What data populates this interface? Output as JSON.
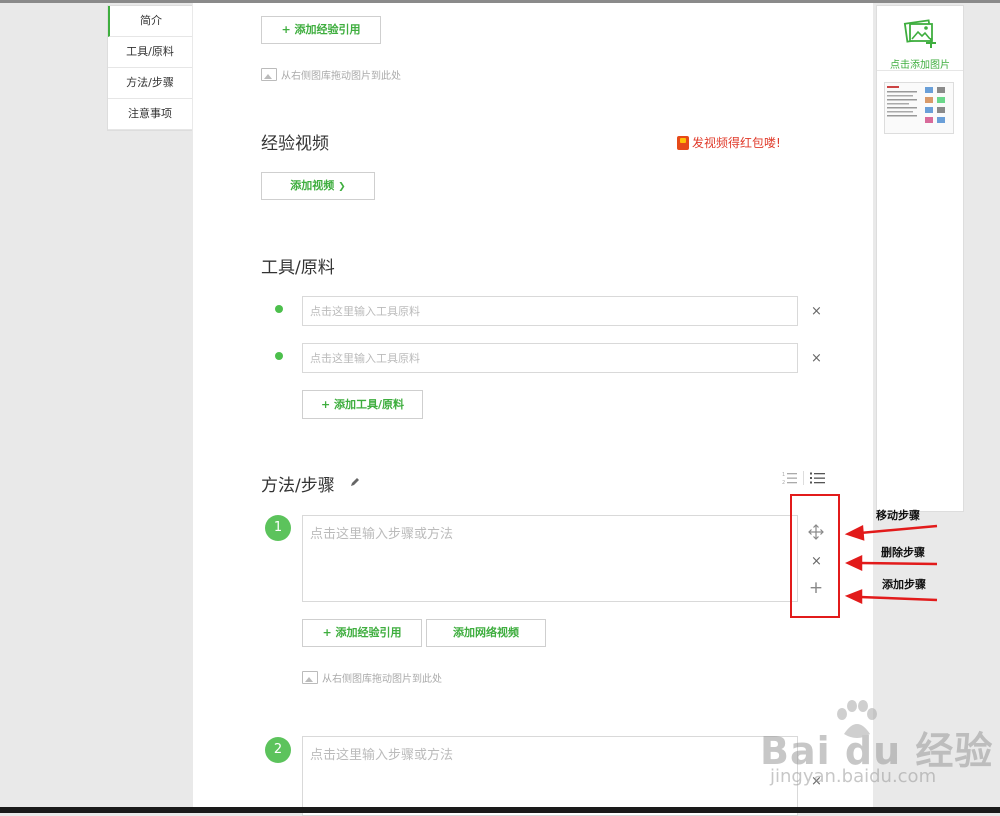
{
  "nav": {
    "items": [
      {
        "label": "简介"
      },
      {
        "label": "工具/原料"
      },
      {
        "label": "方法/步骤"
      },
      {
        "label": "注意事项"
      }
    ]
  },
  "intro": {
    "add_ref_button": "+ 添加经验引用",
    "drag_hint": "从右侧图库拖动图片到此处"
  },
  "video": {
    "title": "经验视频",
    "promo": "发视频得红包喽!",
    "add_button": "添加视频"
  },
  "tools": {
    "title": "工具/原料",
    "items": [
      {
        "placeholder": "点击这里输入工具原料"
      },
      {
        "placeholder": "点击这里输入工具原料"
      }
    ],
    "remove_symbol": "×",
    "add_button": "+ 添加工具/原料"
  },
  "steps": {
    "title": "方法/步骤",
    "items": [
      {
        "number": "1",
        "placeholder": "点击这里输入步骤或方法"
      },
      {
        "number": "2",
        "placeholder": "点击这里输入步骤或方法"
      }
    ],
    "add_ref_button": "+ 添加经验引用",
    "add_web_video_button": "添加网络视频",
    "drag_hint": "从右侧图库拖动图片到此处",
    "icons": {
      "move": "move-arrows-icon",
      "delete": "close-icon",
      "add": "plus-icon"
    }
  },
  "annotations": {
    "move": "移动步骤",
    "delete": "删除步骤",
    "add": "添加步骤"
  },
  "image_panel": {
    "add_label": "点击添加图片"
  },
  "watermark": {
    "brand": "Bai du 经验",
    "url": "jingyan.baidu.com"
  },
  "colors": {
    "accent": "#3fae3f",
    "step_circle": "#5cc35c",
    "annotation_red": "#e21b1b",
    "promo_red": "#e03a2a"
  }
}
